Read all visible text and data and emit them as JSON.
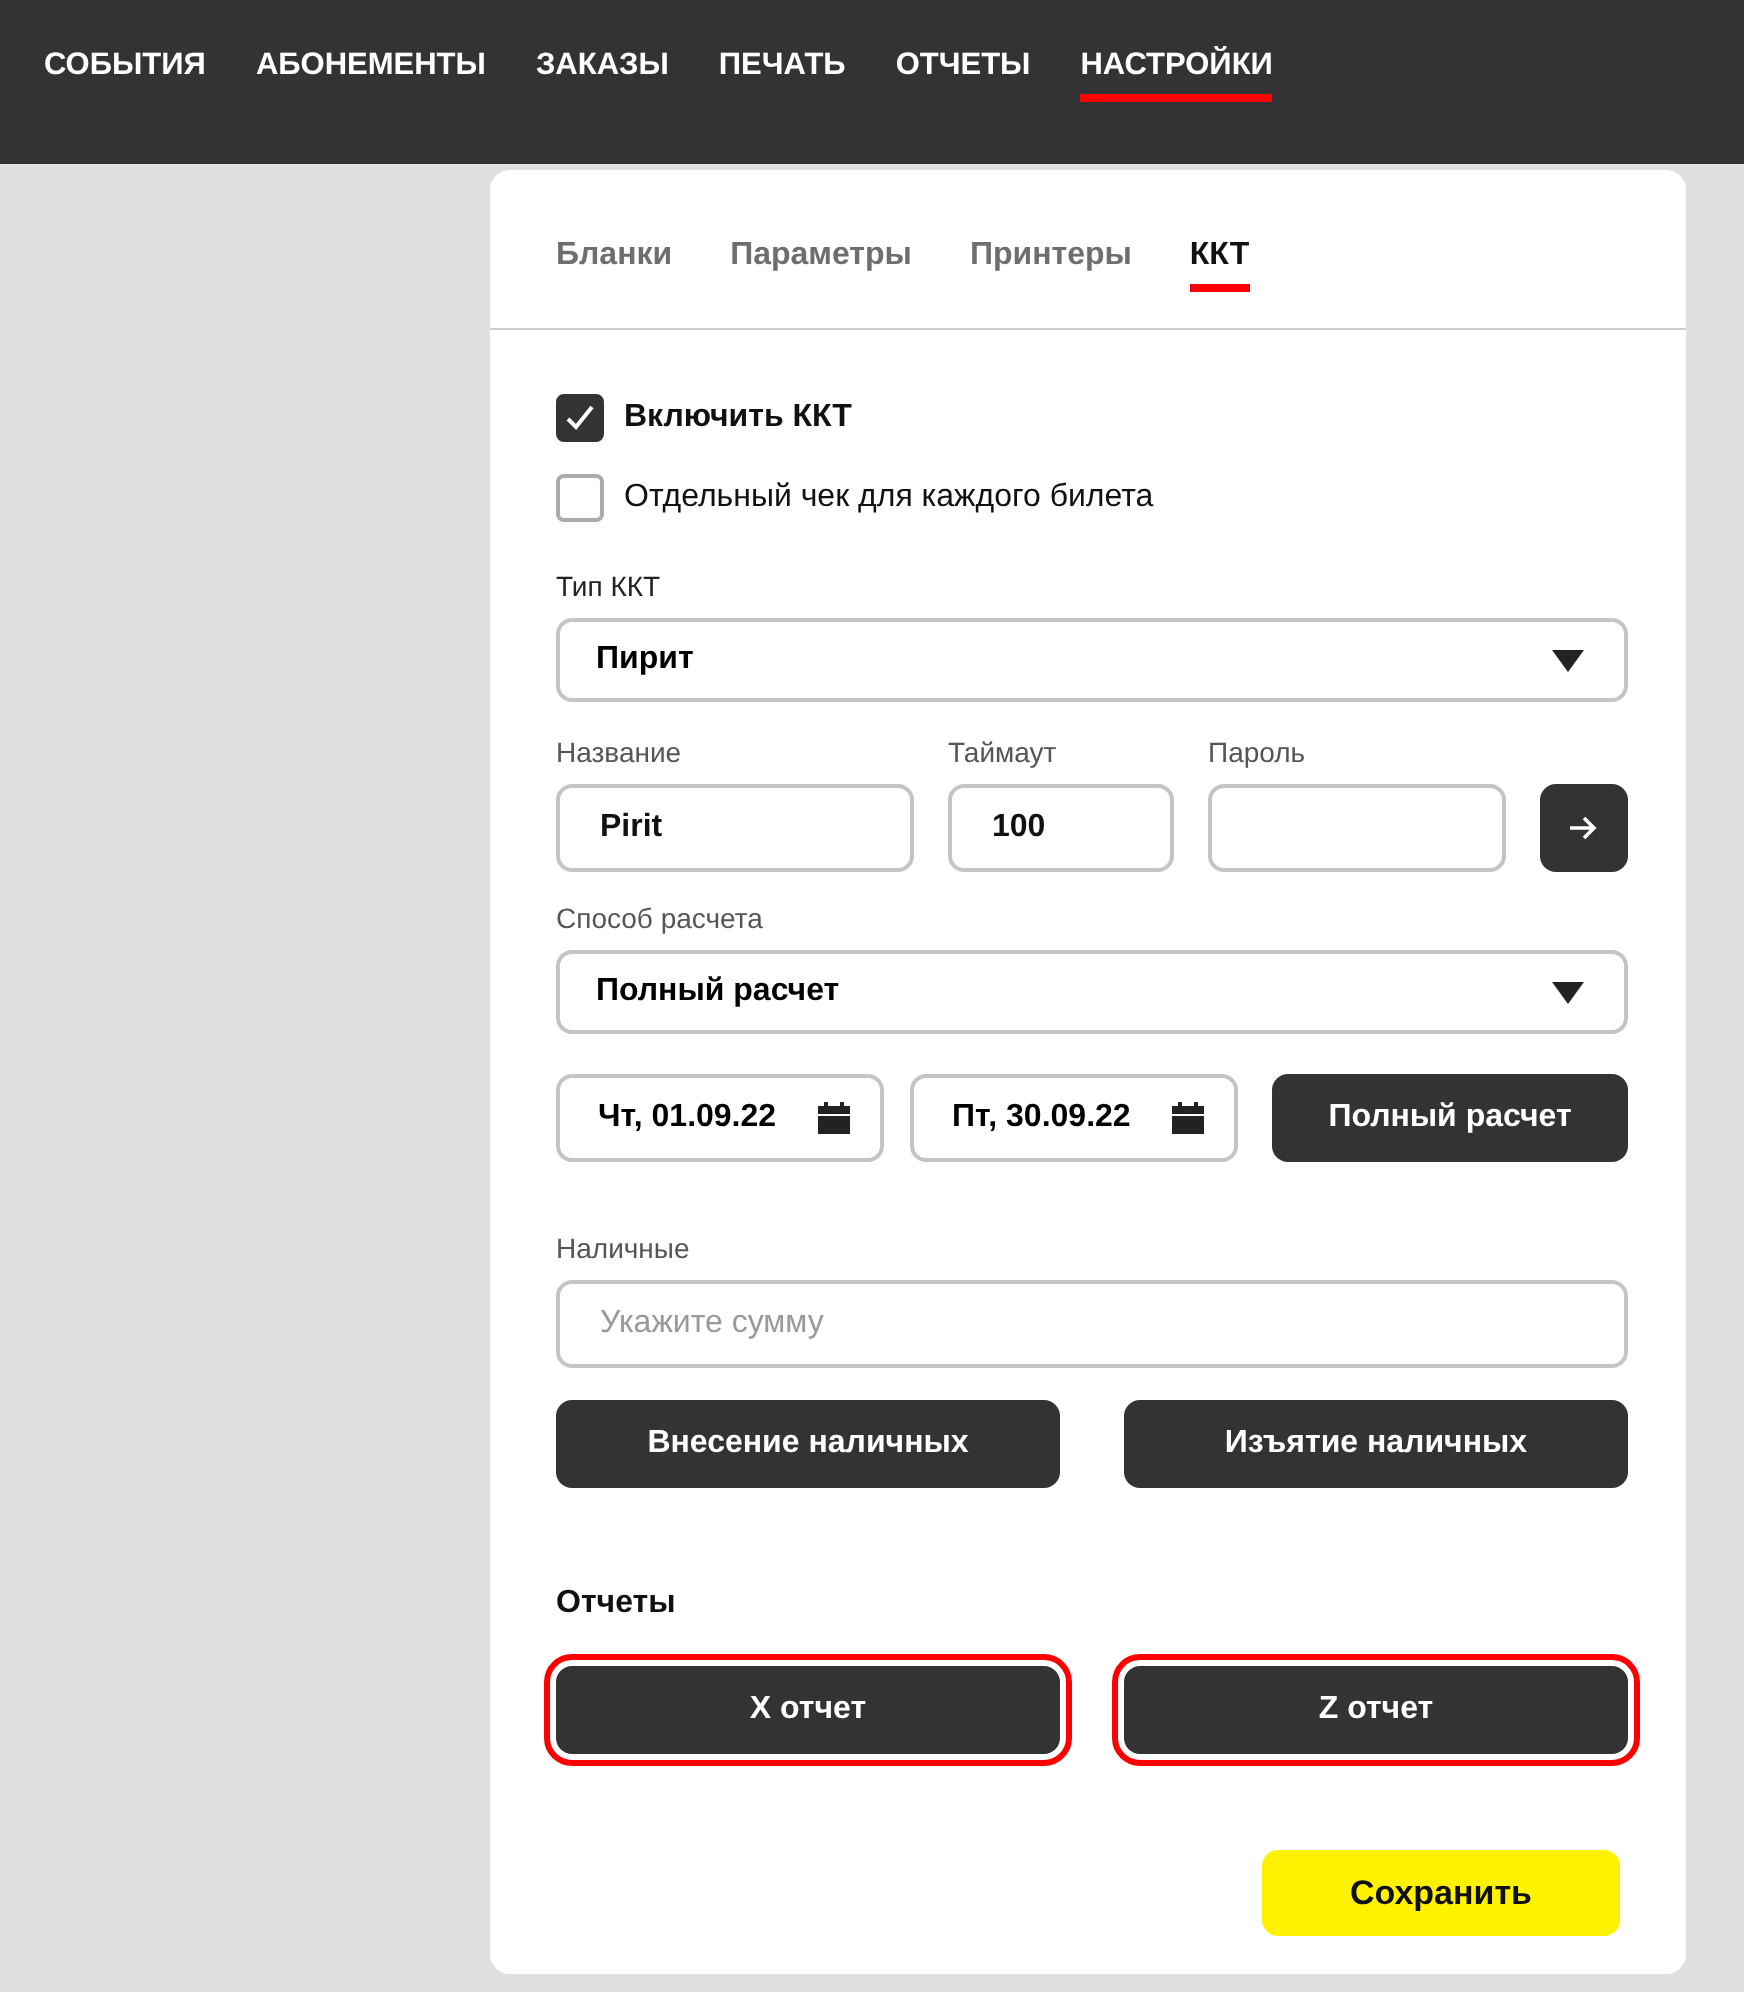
{
  "nav": [
    {
      "label": "СОБЫТИЯ",
      "selected": false
    },
    {
      "label": "АБОНЕМЕНТЫ",
      "selected": false
    },
    {
      "label": "ЗАКАЗЫ",
      "selected": false
    },
    {
      "label": "ПЕЧАТЬ",
      "selected": false
    },
    {
      "label": "ОТЧЕТЫ",
      "selected": false
    },
    {
      "label": "НАСТРОЙКИ",
      "selected": true
    }
  ],
  "tabs": [
    {
      "label": "Бланки",
      "selected": false
    },
    {
      "label": "Параметры",
      "selected": false
    },
    {
      "label": "Принтеры",
      "selected": false
    },
    {
      "label": "ККТ",
      "selected": true
    }
  ],
  "checkboxes": [
    {
      "label": "Включить ККТ",
      "checked": true
    },
    {
      "label": "Отдельный чек для каждого билета",
      "checked": false
    }
  ],
  "kkt_type": {
    "label": "Тип ККТ",
    "value": "Пирит"
  },
  "name_field": {
    "label": "Название",
    "value": "Pirit"
  },
  "timeout_field": {
    "label": "Таймаут",
    "value": "100"
  },
  "password_field": {
    "label": "Пароль"
  },
  "payment_method": {
    "label": "Способ расчета",
    "value": "Полный расчет"
  },
  "date_from": "Чт, 01.09.22",
  "date_to": "Пт, 30.09.22",
  "payment_button": "Полный расчет",
  "cash": {
    "label": "Наличные",
    "placeholder": "Укажите сумму"
  },
  "cash_buttons": [
    "Внесение наличных",
    "Изъятие наличных"
  ],
  "reports": {
    "title": "Отчеты",
    "buttons": [
      {
        "label": "X отчет",
        "highlighted": true
      },
      {
        "label": "Z отчет",
        "highlighted": true
      }
    ]
  },
  "save_button": "Сохранить"
}
